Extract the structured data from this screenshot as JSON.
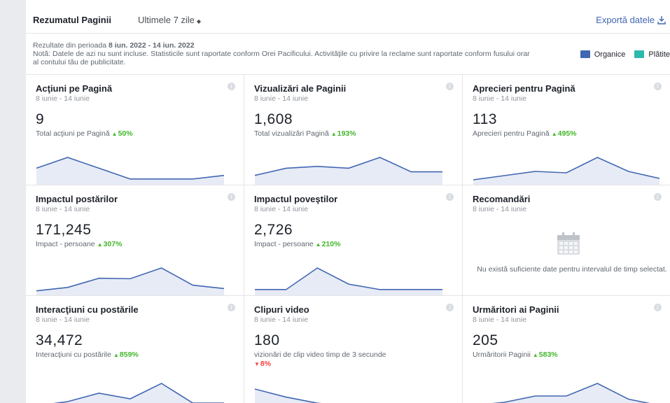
{
  "header": {
    "title": "Rezumatul Paginii",
    "period": "Ultimele 7 zile",
    "export": "Exportă datele"
  },
  "notes": {
    "range_prefix": "Rezultate din perioada",
    "range_value": "8 iun. 2022 - 14 iun. 2022",
    "note": "Notă: Datele de azi nu sunt incluse. Statisticile sunt raportate conform Orei Pacificului. Activităţile cu privire la reclame sunt raportate conform fusului orar al contului tău de publicitate."
  },
  "legend": {
    "organic": {
      "label": "Organice",
      "color": "#4267b2"
    },
    "paid": {
      "label": "Plătite",
      "color": "#2bbbad"
    }
  },
  "colors": {
    "line": "#4267b2",
    "fill": "#e7ebf6",
    "positive": "#42b72a",
    "negative": "#fa3e3e"
  },
  "cards": [
    {
      "title": "Acţiuni pe Pagină",
      "date": "8 iunie - 14 iunie",
      "value": "9",
      "sub": "Total acţiuni pe Pagină",
      "pct": "50%",
      "dir": "up",
      "series": [
        4,
        7,
        4,
        1,
        1,
        1,
        2
      ]
    },
    {
      "title": "Vizualizări ale Paginii",
      "date": "8 iunie - 14 iunie",
      "value": "1,608",
      "sub": "Total vizualizări Pagină",
      "pct": "193%",
      "dir": "up",
      "series": [
        2,
        4,
        4.5,
        4,
        7,
        3,
        3
      ]
    },
    {
      "title": "Aprecieri pentru Pagină",
      "date": "8 iunie - 14 iunie",
      "value": "113",
      "sub": "Aprecieri pentru Pagină",
      "pct": "495%",
      "dir": "up",
      "series": [
        1,
        2.5,
        4,
        3.5,
        9,
        4,
        1.5
      ]
    },
    {
      "title": "Impactul postărilor",
      "date": "8 iunie - 14 iunie",
      "value": "171,245",
      "sub": "Impact - persoane",
      "pct": "307%",
      "dir": "up",
      "series": [
        1,
        2.5,
        6.5,
        6.3,
        11,
        3.5,
        2
      ]
    },
    {
      "title": "Impactul poveştilor",
      "date": "8 iunie - 14 iunie",
      "value": "2,726",
      "sub": "Impact - persoane",
      "pct": "210%",
      "dir": "up",
      "series": [
        1,
        1,
        7,
        2.5,
        1,
        1,
        1
      ]
    },
    {
      "title": "Recomandări",
      "date": "8 iunie - 14 iunie",
      "message": "Nu există suficiente date pentru intervalul de timp selectat."
    },
    {
      "title": "Interacţiuni cu postările",
      "date": "8 iunie - 14 iunie",
      "value": "34,472",
      "sub": "Interacţiuni cu postările",
      "pct": "859%",
      "dir": "up",
      "series": [
        1,
        2.5,
        5.5,
        3.5,
        9,
        2,
        2
      ]
    },
    {
      "title": "Clipuri video",
      "date": "8 iunie - 14 iunie",
      "value": "180",
      "sub": "vizionări de clip video timp de 3 secunde",
      "pct": "8%",
      "dir": "down",
      "series": [
        9,
        5,
        2,
        0.5,
        1.5,
        0.5,
        1
      ]
    },
    {
      "title": "Urmăritori ai Paginii",
      "date": "8 iunie - 14 iunie",
      "value": "205",
      "sub": "Urmăritorii Paginii",
      "pct": "583%",
      "dir": "up",
      "series": [
        1,
        2,
        4,
        4,
        8,
        3,
        1
      ]
    }
  ]
}
